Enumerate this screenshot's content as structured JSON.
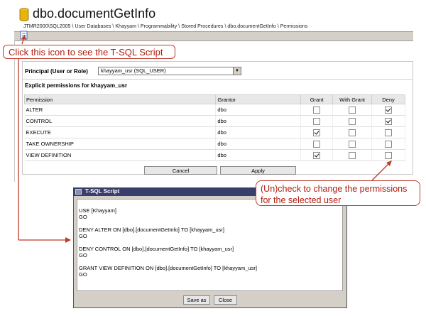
{
  "window": {
    "title": "dbo.documentGetInfo",
    "breadcrumb": "JTMR2000\\SQL2005 \\ User Databases \\ Khayyam \\ Programmability \\ Stored Procedures \\ dbo.documentGetInfo \\ Permissions"
  },
  "callouts": {
    "script_hint": "Click this icon to see the T-SQL Script",
    "perm_hint_line1": "(Un)check to change the permissions",
    "perm_hint_line2": "for the selected user"
  },
  "form": {
    "principal_label": "Principal (User or Role)",
    "principal_value": "khayyam_usr (SQL_USER)",
    "explicit_label": "Explicit permissions for khayyam_usr"
  },
  "table": {
    "headers": [
      "Permission",
      "Grantor",
      "Grant",
      "With Grant",
      "Deny"
    ],
    "rows": [
      {
        "permission": "ALTER",
        "grantor": "dbo",
        "grant": false,
        "with_grant": false,
        "deny": true
      },
      {
        "permission": "CONTROL",
        "grantor": "dbo",
        "grant": false,
        "with_grant": false,
        "deny": true
      },
      {
        "permission": "EXECUTE",
        "grantor": "dbo",
        "grant": true,
        "with_grant": false,
        "deny": false
      },
      {
        "permission": "TAKE OWNERSHIP",
        "grantor": "dbo",
        "grant": false,
        "with_grant": false,
        "deny": false
      },
      {
        "permission": "VIEW DEFINITION",
        "grantor": "dbo",
        "grant": true,
        "with_grant": false,
        "deny": false
      }
    ]
  },
  "buttons": {
    "cancel": "Cancel",
    "apply": "Apply"
  },
  "dialog": {
    "title": "T-SQL Script",
    "script": "USE [Khayyam]\nGO\n\nDENY ALTER ON [dbo].[documentGetInfo] TO [khayyam_usr]\nGO\n\nDENY CONTROL ON [dbo].[documentGetInfo] TO [khayyam_usr]\nGO\n\nGRANT VIEW DEFINITION ON [dbo].[documentGetInfo] TO [khayyam_usr]\nGO",
    "save_as": "Save as",
    "close": "Close"
  },
  "colors": {
    "callout": "#b01e10",
    "dialog_title_bar": "#3a3e6b",
    "chrome": "#d4d0c8"
  },
  "icons": {
    "database": "database-icon",
    "script": "script-icon",
    "dialog": "window-icon"
  }
}
